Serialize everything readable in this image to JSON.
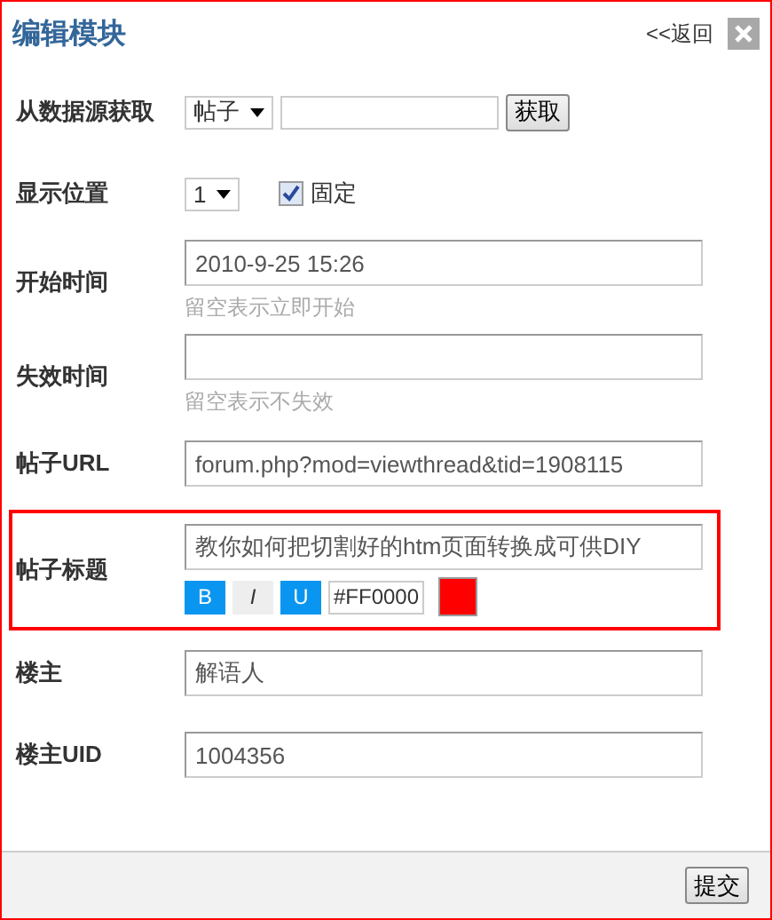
{
  "window": {
    "title": "编辑模块",
    "back_link": "<<返回"
  },
  "rows": [
    {
      "kind": "source",
      "label": "从数据源获取",
      "select": "帖子",
      "value_field": "",
      "button": "获取"
    },
    {
      "kind": "position",
      "label": "显示位置",
      "select": "1",
      "checkbox": {
        "label": "固定",
        "checked": true
      }
    },
    {
      "kind": "text",
      "label": "开始时间",
      "value": "2010-9-25 15:26",
      "hint": "留空表示立即开始",
      "highlighted": false
    },
    {
      "kind": "text",
      "label": "失效时间",
      "value": "",
      "hint": "留空表示不失效",
      "highlighted": false
    },
    {
      "kind": "text",
      "label": "帖子URL",
      "value": "forum.php?mod=viewthread&tid=1908115",
      "highlighted": false
    },
    {
      "kind": "title",
      "label": "帖子标题",
      "value": "教你如何把切割好的htm页面转换成可供DIY",
      "highlighted": true,
      "format": [
        {
          "label": "B",
          "selected": true
        },
        {
          "label": "I",
          "selected": false
        },
        {
          "label": "U",
          "selected": true
        }
      ],
      "color_code": "#FF0000",
      "color": "#ff0000"
    },
    {
      "kind": "text",
      "label": "楼主",
      "value": "解语人",
      "highlighted": false
    },
    {
      "kind": "text",
      "label": "楼主UID",
      "value": "1004356",
      "highlighted": false
    }
  ],
  "footer": {
    "button": "提交"
  }
}
